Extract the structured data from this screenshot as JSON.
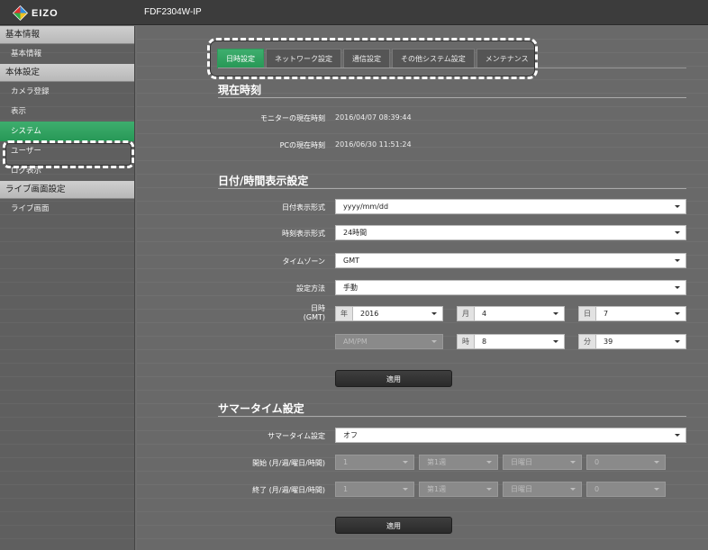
{
  "header": {
    "logo_text": "EIZO",
    "device_name": "FDF2304W-IP"
  },
  "sidebar": {
    "groups": [
      {
        "title": "基本情報",
        "items": [
          "基本情報"
        ]
      },
      {
        "title": "本体設定",
        "items": [
          "カメラ登録",
          "表示",
          "システム",
          "ユーザー",
          "ログ表示"
        ]
      },
      {
        "title": "ライブ画面設定",
        "items": [
          "ライブ画面"
        ]
      }
    ],
    "active_item": "システム"
  },
  "tabs": [
    "日時設定",
    "ネットワーク設定",
    "通信設定",
    "その他システム設定",
    "メンテナンス"
  ],
  "active_tab": "日時設定",
  "current_time": {
    "title": "現在時刻",
    "monitor_label": "モニターの現在時刻",
    "monitor_value": "2016/04/07 08:39:44",
    "pc_label": "PCの現在時刻",
    "pc_value": "2016/06/30 11:51:24"
  },
  "datetime_display": {
    "title": "日付/時間表示設定",
    "date_format_label": "日付表示形式",
    "date_format_value": "yyyy/mm/dd",
    "time_format_label": "時刻表示形式",
    "time_format_value": "24時間",
    "timezone_label": "タイムゾーン",
    "timezone_value": "GMT",
    "method_label": "設定方法",
    "method_value": "手動",
    "datetime_label_1": "日時",
    "datetime_label_2": "(GMT)",
    "year_unit": "年",
    "year_value": "2016",
    "month_unit": "月",
    "month_value": "4",
    "day_unit": "日",
    "day_value": "7",
    "ampm_value": "AM/PM",
    "hour_unit": "時",
    "hour_value": "8",
    "minute_unit": "分",
    "minute_value": "39",
    "apply_label": "適用"
  },
  "summer_time": {
    "title": "サマータイム設定",
    "setting_label": "サマータイム設定",
    "setting_value": "オフ",
    "start_label": "開始 (月/週/曜日/時間)",
    "end_label": "終了 (月/週/曜日/時間)",
    "start_values": [
      "1",
      "第1週",
      "日曜日",
      "0"
    ],
    "end_values": [
      "1",
      "第1週",
      "日曜日",
      "0"
    ],
    "apply_label": "適用"
  },
  "colors": {
    "accent_green": "#2fa35f",
    "highlight_border": "#ffffff"
  }
}
